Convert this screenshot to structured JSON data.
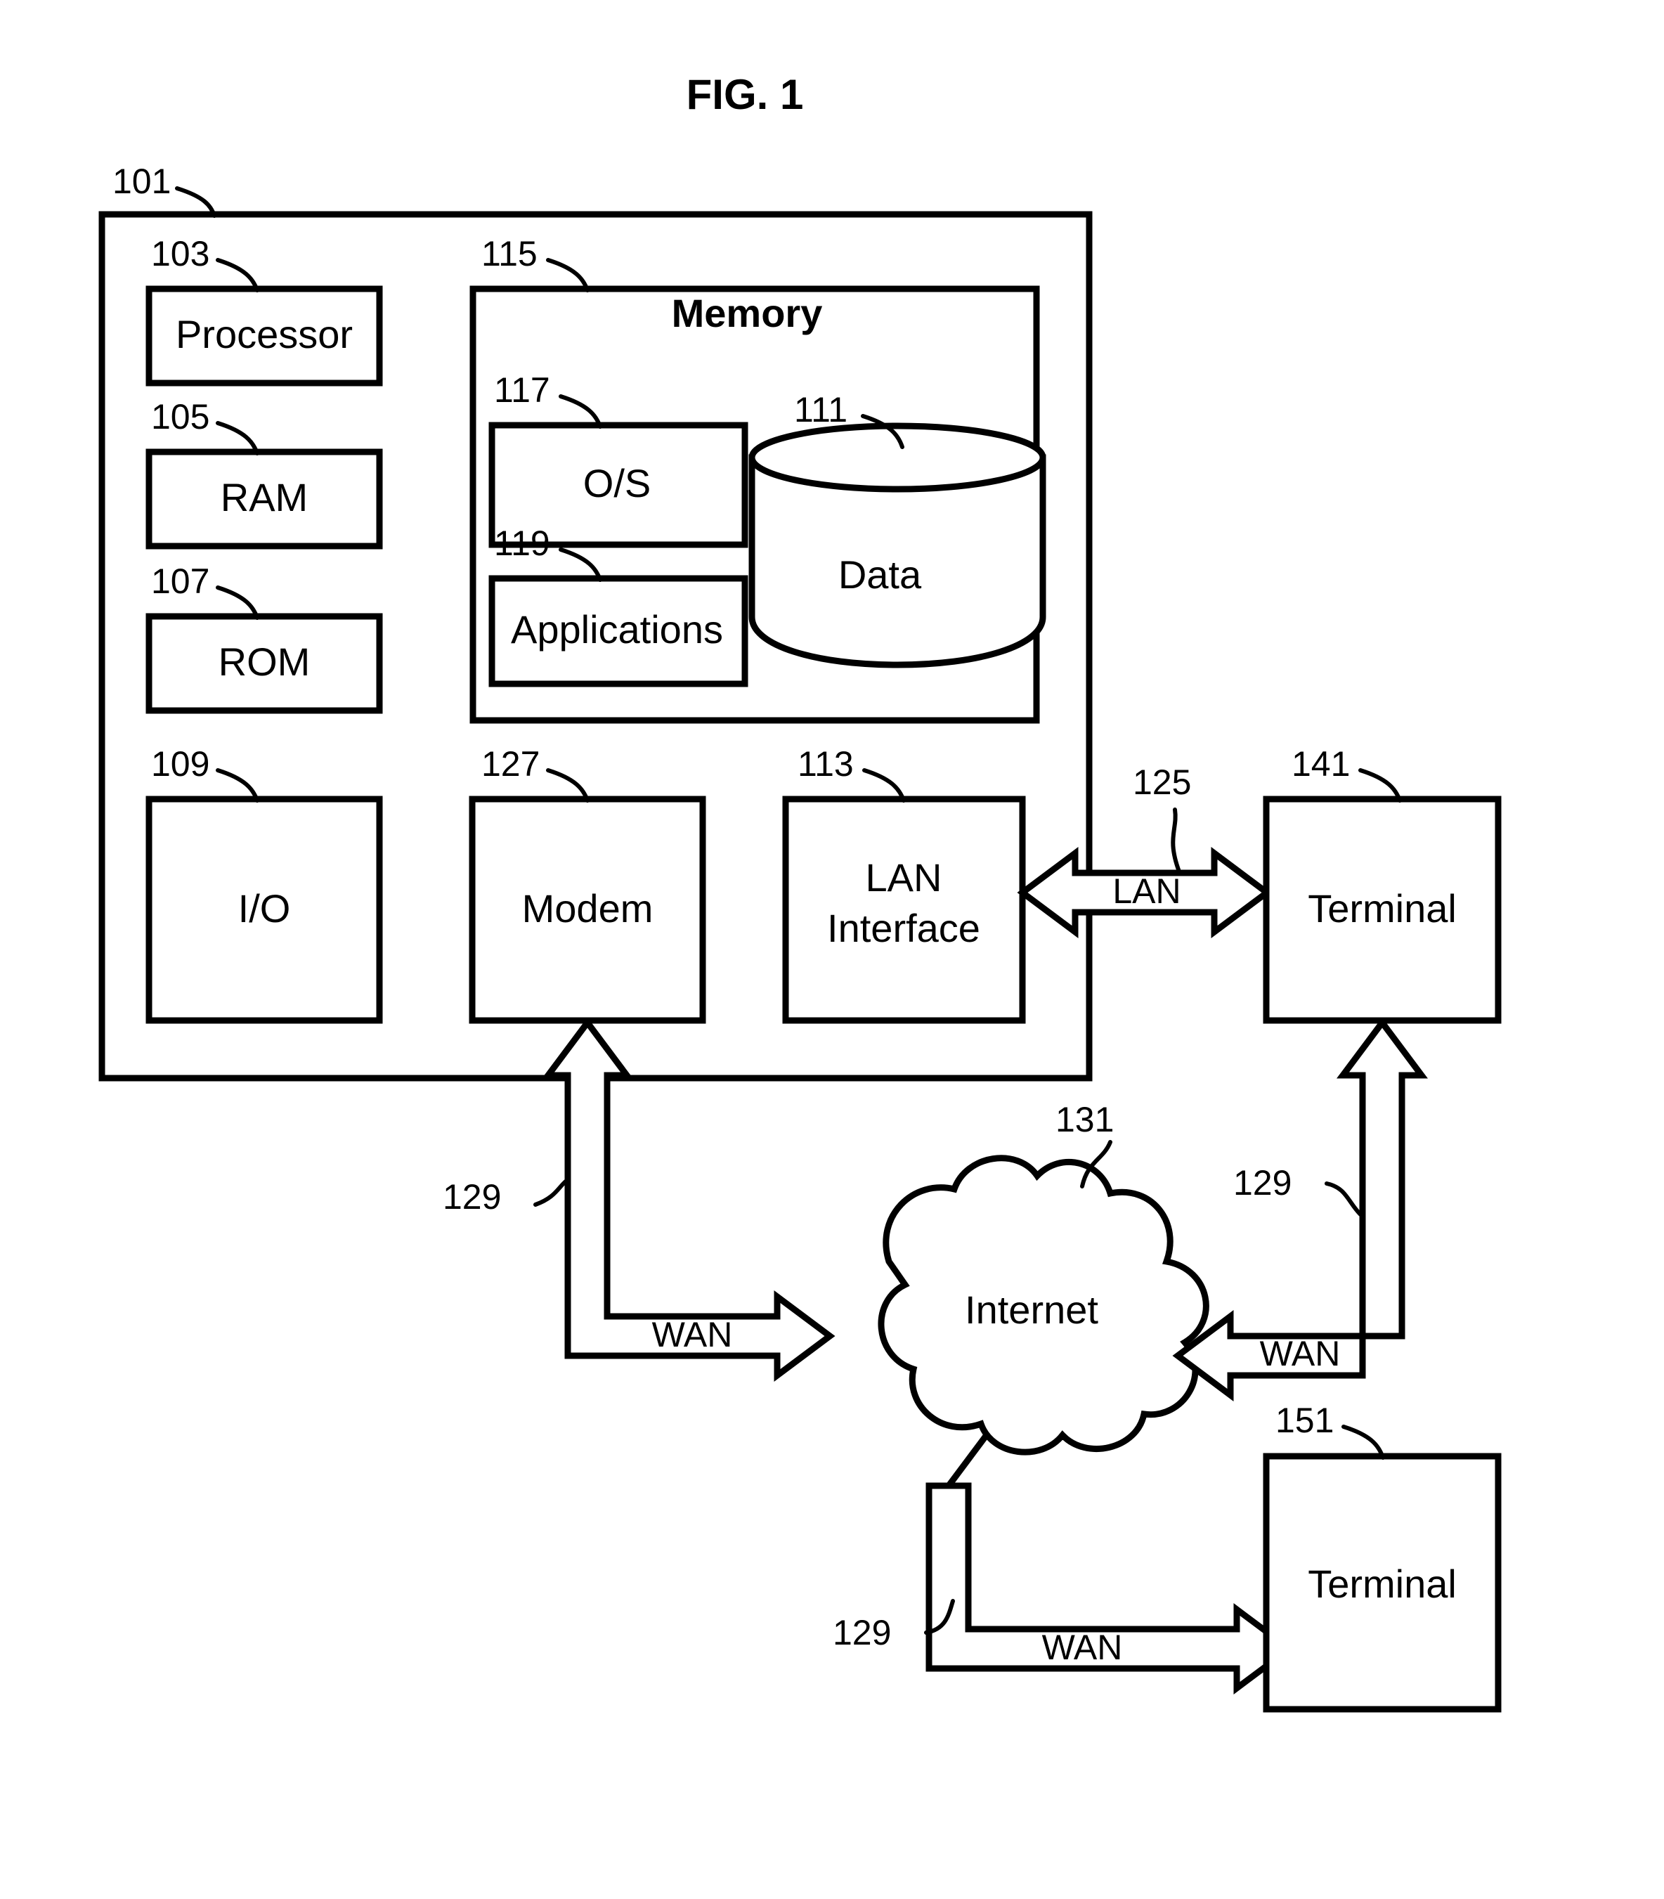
{
  "figure": {
    "title": "FIG. 1",
    "domain_kind": "patent-block-diagram"
  },
  "nodes": {
    "computing_device": {
      "ref": "101",
      "label": ""
    },
    "processor": {
      "ref": "103",
      "label": "Processor"
    },
    "ram": {
      "ref": "105",
      "label": "RAM"
    },
    "rom": {
      "ref": "107",
      "label": "ROM"
    },
    "io": {
      "ref": "109",
      "label": "I/O"
    },
    "memory": {
      "ref": "115",
      "label": "Memory"
    },
    "os": {
      "ref": "117",
      "label": "O/S"
    },
    "applications": {
      "ref": "119",
      "label": "Applications"
    },
    "data": {
      "ref": "111",
      "label": "Data"
    },
    "modem": {
      "ref": "127",
      "label": "Modem"
    },
    "lan_interface": {
      "ref": "113",
      "label_line1": "LAN",
      "label_line2": "Interface"
    },
    "terminal_lan": {
      "ref": "141",
      "label": "Terminal"
    },
    "internet": {
      "ref": "131",
      "label": "Internet"
    },
    "terminal_wan": {
      "ref": "151",
      "label": "Terminal"
    }
  },
  "links": {
    "lan": {
      "ref": "125",
      "label": "LAN"
    },
    "wan_modem": {
      "ref": "129",
      "label": "WAN"
    },
    "wan_terminal141": {
      "ref": "129",
      "label": "WAN"
    },
    "wan_terminal151": {
      "ref": "129",
      "label": "WAN"
    }
  },
  "colors": {
    "ink": "#000000",
    "paper": "#ffffff"
  }
}
